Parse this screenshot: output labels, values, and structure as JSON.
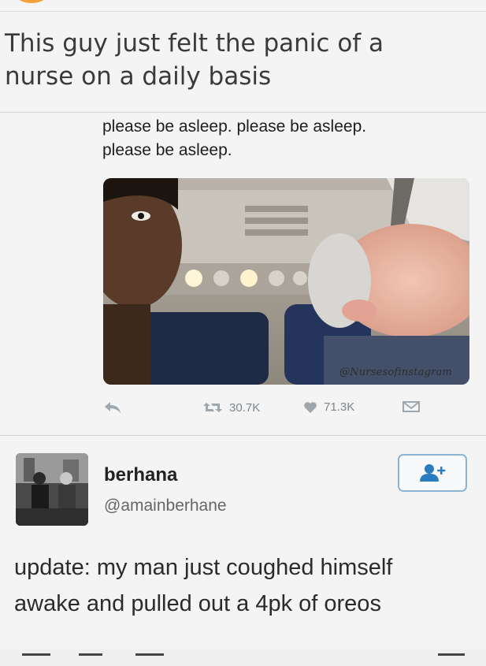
{
  "caption": {
    "line1": "This guy just felt the panic of a",
    "line2": "nurse on a daily basis"
  },
  "tweet1": {
    "text_line1": "please be asleep. please be asleep.",
    "text_line2": "please be asleep.",
    "watermark": "@Nursesofinstagram",
    "retweets": "30.7K",
    "likes": "71.3K",
    "icons": [
      "reply-icon",
      "retweet-icon",
      "heart-icon",
      "message-icon"
    ]
  },
  "tweet2": {
    "display_name": "berhana",
    "handle": "@amainberhane",
    "text_line1": "update: my man just coughed himself",
    "text_line2": "awake and pulled out a 4pk of oreos",
    "follow_icon": "follow-user-icon"
  },
  "colors": {
    "accent": "#2b7bbf",
    "action_gray": "#9ea6ae"
  }
}
